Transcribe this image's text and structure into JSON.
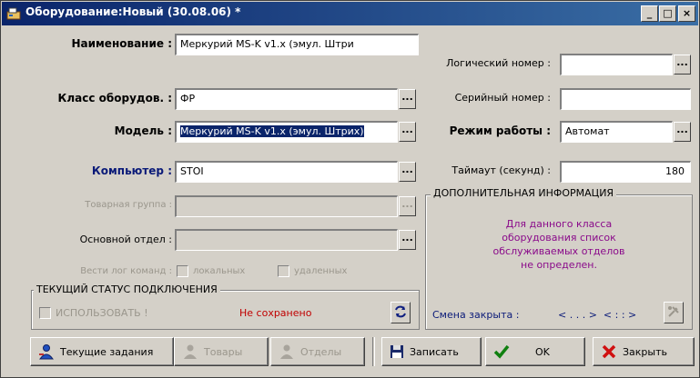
{
  "window": {
    "title": "Оборудование:Новый (30.08.06) *",
    "controls": {
      "minimize": "_",
      "maximize": "□",
      "close": "×"
    }
  },
  "fields": {
    "name": {
      "label": "Наименование :",
      "value": "Меркурий MS-K v1.x (эмул. Штри"
    },
    "equipment_class": {
      "label": "Класс оборудов. :",
      "value": "ФР"
    },
    "model": {
      "label": "Модель :",
      "value": "Меркурий MS-K v1.x (эмул. Штрих)"
    },
    "computer": {
      "label": "Компьютер :",
      "value": "STOI"
    },
    "product_group": {
      "label": "Товарная группа :",
      "value": ""
    },
    "main_department": {
      "label": "Основной отдел :",
      "value": ""
    },
    "logical_number": {
      "label": "Логический номер :",
      "value": ""
    },
    "serial_number": {
      "label": "Серийный номер :",
      "value": ""
    },
    "work_mode": {
      "label": "Режим работы :",
      "value": "Автомат"
    },
    "timeout": {
      "label": "Таймаут (секунд) :",
      "value": "180"
    }
  },
  "ellipsis_label": "...",
  "command_log": {
    "label": "Вести лог команд :",
    "local_label": "локальных",
    "remote_label": "удаленных"
  },
  "connection_status": {
    "title": "ТЕКУЩИЙ СТАТУС ПОДКЛЮЧЕНИЯ",
    "use_label": "ИСПОЛЬЗОВАТЬ !",
    "status_text": "Не сохранено"
  },
  "additional_info": {
    "title": "ДОПОЛНИТЕЛЬНАЯ ИНФОРМАЦИЯ",
    "message_lines": [
      "Для данного класса",
      "оборудования список",
      "обслуживаемых отделов",
      "не определен."
    ],
    "shift_label": "Смена закрыта :",
    "shift_value": "< . . . >  < : : >"
  },
  "buttons": {
    "current_tasks": "Текущие задания",
    "goods": "Товары",
    "departments": "Отделы",
    "save": "Записать",
    "ok": "OK",
    "close": "Закрыть"
  },
  "colors": {
    "title_bar_start": "#0a246a",
    "title_bar_end": "#3a6ea5",
    "window_bg": "#d4d0c8",
    "blue_label": "#0a1a78",
    "status_red": "#c00000",
    "info_purple": "#8a0a8a"
  }
}
